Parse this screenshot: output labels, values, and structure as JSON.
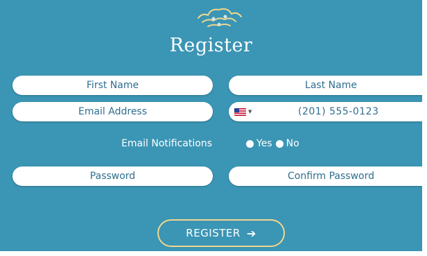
{
  "form": {
    "title": "Register",
    "first_name_placeholder": "First Name",
    "last_name_placeholder": "Last Name",
    "email_placeholder": "Email Address",
    "phone_value": "(201) 555-0123",
    "phone_country_icon": "us-flag-icon",
    "notifications_label": "Email Notifications",
    "notification_options": [
      "Yes",
      "No"
    ],
    "password_placeholder": "Password",
    "confirm_password_placeholder": "Confirm Password",
    "submit_label": "REGISTER",
    "submit_icon": "arrow-right-icon"
  },
  "colors": {
    "background": "#3b95b5",
    "field_text": "#2e6f8f",
    "button_border": "#f0d78c",
    "logo_accent": "#f0d78c"
  }
}
